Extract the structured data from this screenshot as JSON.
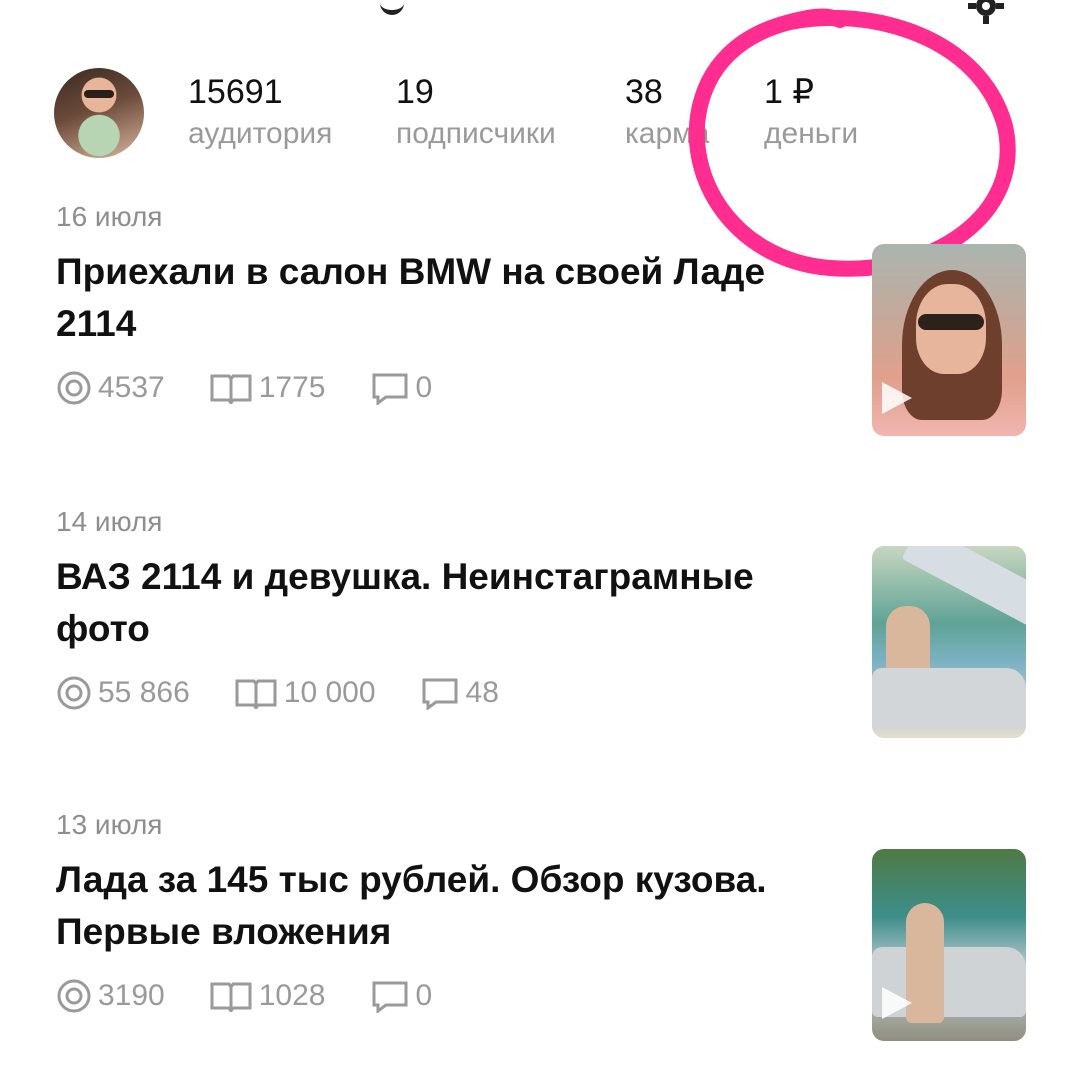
{
  "profile": {
    "stats": [
      {
        "value": "15691",
        "label": "аудитория"
      },
      {
        "value": "19",
        "label": "подписчики"
      },
      {
        "value": "38",
        "label": "карма"
      },
      {
        "value": "1 ₽",
        "label": "деньги"
      }
    ]
  },
  "articles": [
    {
      "date": "16 июля",
      "title": "Приехали в салон BMW на своей Ладе 2114",
      "views": "4537",
      "reads": "1775",
      "comments": "0"
    },
    {
      "date": "14 июля",
      "title": "ВАЗ 2114 и девушка. Неинстаграмные фото",
      "views": "55 866",
      "reads": "10 000",
      "comments": "48"
    },
    {
      "date": "13 июля",
      "title": "Лада за 145 тыс рублей. Обзор кузова. Первые вложения",
      "views": "3190",
      "reads": "1028",
      "comments": "0"
    }
  ],
  "colors": {
    "annotation": "#ff2d8f",
    "muted": "#9a9a9a",
    "text": "#111111"
  },
  "icons": [
    "gear-icon",
    "views-icon",
    "reads-icon",
    "comments-icon",
    "play-icon"
  ]
}
